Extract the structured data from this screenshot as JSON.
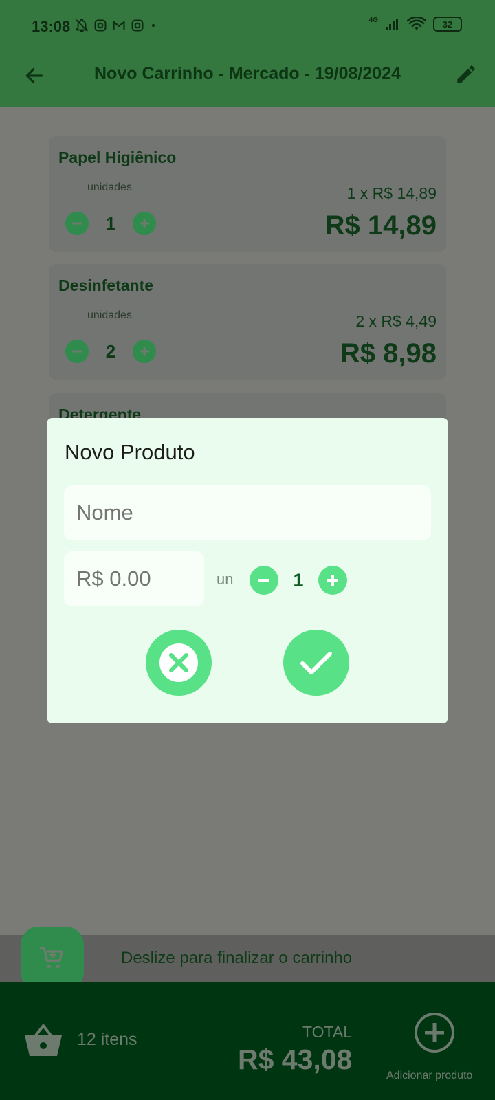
{
  "status_bar": {
    "time": "13:08",
    "network": "4G",
    "battery": "32",
    "icons_left": [
      "bell-off-icon",
      "instagram-icon",
      "gmail-icon",
      "instagram-icon",
      "dot-icon"
    ]
  },
  "app_bar": {
    "title": "Novo Carrinho - Mercado - 19/08/2024"
  },
  "cart_items": [
    {
      "name": "Papel Higiênico",
      "unit_label": "unidades",
      "quantity": "1",
      "unit_price_text": "1 x R$ 14,89",
      "total": "R$ 14,89"
    },
    {
      "name": "Desinfetante",
      "unit_label": "unidades",
      "quantity": "2",
      "unit_price_text": "2 x R$ 4,49",
      "total": "R$ 8,98"
    },
    {
      "name": "Detergente"
    }
  ],
  "swipe_bar": {
    "label": "Deslize para finalizar o carrinho"
  },
  "bottom_bar": {
    "items_count": "12 itens",
    "total_label": "TOTAL",
    "total_value": "R$ 43,08",
    "add_label": "Adicionar produto"
  },
  "dialog": {
    "title": "Novo Produto",
    "name_placeholder": "Nome",
    "price_placeholder": "R$ 0.00",
    "unit_label": "un",
    "quantity": "1"
  },
  "colors": {
    "app_bar": "#34783f",
    "accent": "#58e186",
    "dark_green": "#003511",
    "dialog_bg": "#eafcee"
  }
}
